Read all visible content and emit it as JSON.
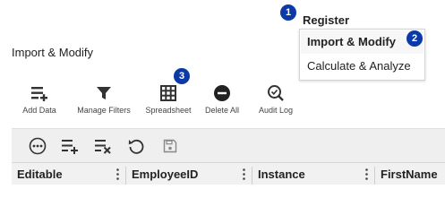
{
  "page": {
    "title": "Import & Modify"
  },
  "menu": {
    "register_label": "Register",
    "items": [
      {
        "label": "Import & Modify",
        "active": true
      },
      {
        "label": "Calculate & Analyze",
        "active": false
      }
    ]
  },
  "badges": [
    "1",
    "2",
    "3"
  ],
  "toolbar": {
    "items": [
      {
        "label": "Add Data",
        "icon": "add-list-icon"
      },
      {
        "label": "Manage Filters",
        "icon": "filter-icon"
      },
      {
        "label": "Spreadsheet",
        "icon": "grid-icon"
      },
      {
        "label": "Delete All",
        "icon": "minus-circle-icon"
      },
      {
        "label": "Audit Log",
        "icon": "search-check-icon"
      }
    ]
  },
  "grid_toolbar": {
    "icons": [
      "more-icon",
      "add-row-icon",
      "delete-row-icon",
      "undo-icon",
      "save-icon"
    ]
  },
  "table": {
    "columns": [
      "Editable",
      "EmployeeID",
      "Instance",
      "FirstName"
    ]
  },
  "colors": {
    "accent": "#0b3aa8",
    "icon": "#333333"
  }
}
